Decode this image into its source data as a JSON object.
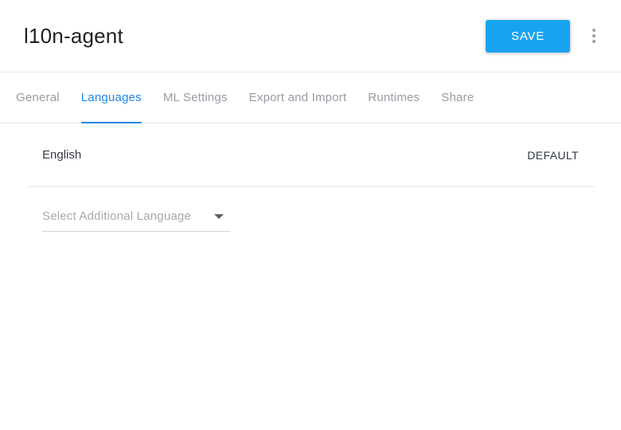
{
  "header": {
    "title": "l10n-agent",
    "save_label": "SAVE",
    "kebab_icon": "vertical-dots-menu"
  },
  "tabs": [
    {
      "label": "General",
      "active": false
    },
    {
      "label": "Languages",
      "active": true
    },
    {
      "label": "ML Settings",
      "active": false
    },
    {
      "label": "Export and Import",
      "active": false
    },
    {
      "label": "Runtimes",
      "active": false
    },
    {
      "label": "Share",
      "active": false
    }
  ],
  "languages_panel": {
    "default_language": "English",
    "default_badge": "DEFAULT",
    "add_language_placeholder": "Select Additional Language",
    "dropdown_icon": "caret-down"
  },
  "colors": {
    "accent_blue": "#18a3f1",
    "tab_active_blue": "#1e88e5",
    "text_dark": "#343a44",
    "tab_inactive": "#979ca4",
    "placeholder_gray": "#a9a9a9"
  }
}
